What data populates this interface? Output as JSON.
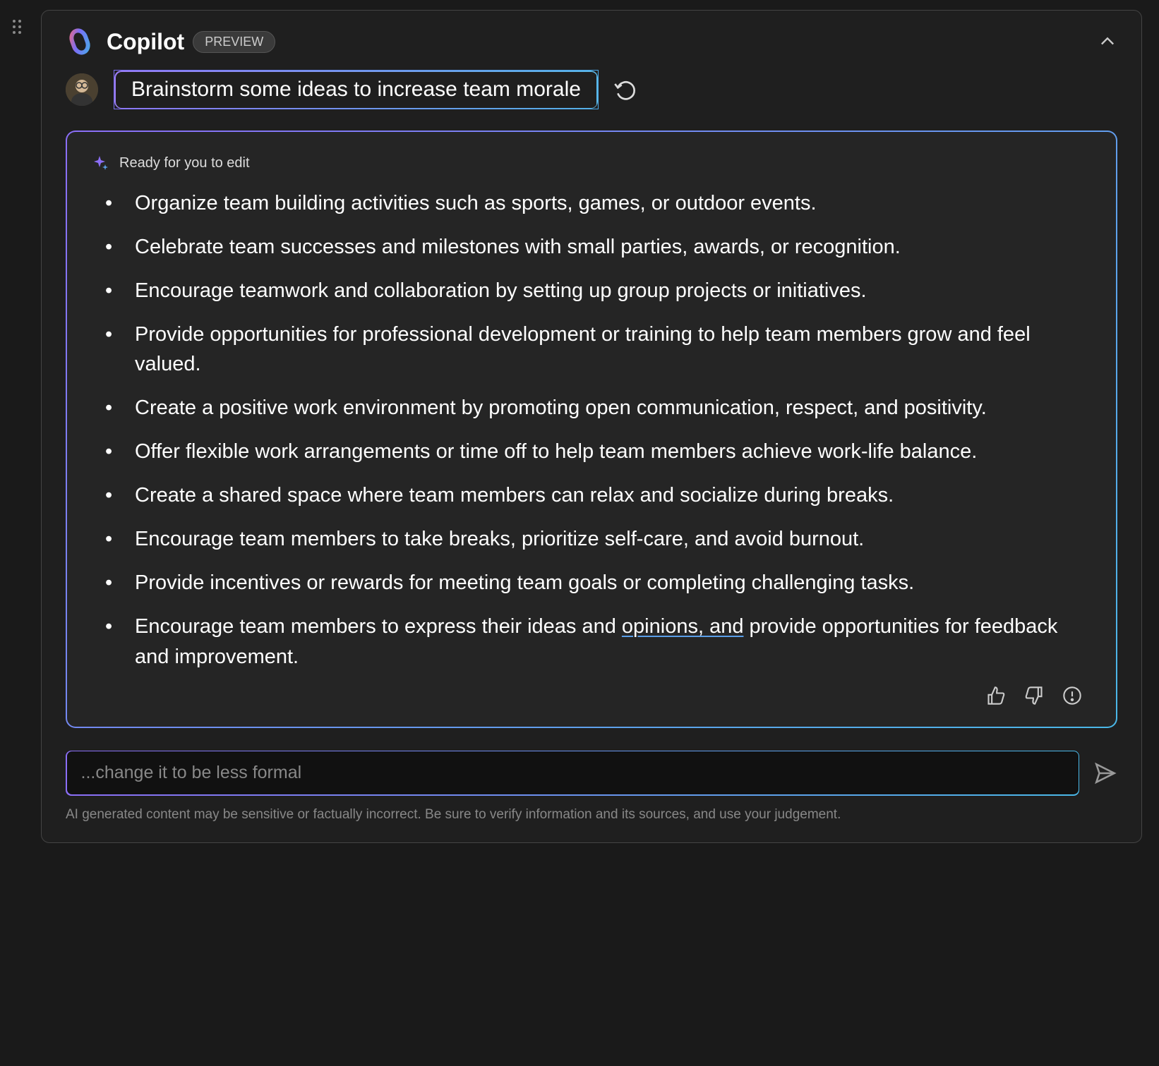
{
  "header": {
    "title": "Copilot",
    "badge": "PREVIEW"
  },
  "prompt": {
    "text": "Brainstorm some ideas to increase team morale"
  },
  "response": {
    "status": "Ready for you to edit",
    "items": [
      "Organize team building activities such as sports, games, or outdoor events.",
      "Celebrate team successes and milestones with small parties, awards, or recognition.",
      "Encourage teamwork and collaboration by setting up group projects or initiatives.",
      "Provide opportunities for professional development or training to help team members grow and feel valued.",
      "Create a positive work environment by promoting open communication, respect, and positivity.",
      "Offer flexible work arrangements or time off to help team members achieve work-life balance.",
      "Create a shared space where team members can relax and socialize during breaks.",
      "Encourage team members to take breaks, prioritize self-care, and avoid burnout.",
      "Provide incentives or rewards for meeting team goals or completing challenging tasks."
    ],
    "last_item": {
      "before": "Encourage team members to express their ideas and ",
      "underlined": "opinions, and",
      "after": " provide opportunities for feedback and improvement."
    }
  },
  "input": {
    "placeholder": "...change it to be less formal",
    "value": ""
  },
  "disclaimer": "AI generated content may be sensitive or factually incorrect. Be sure to verify information and its sources, and use your judgement."
}
